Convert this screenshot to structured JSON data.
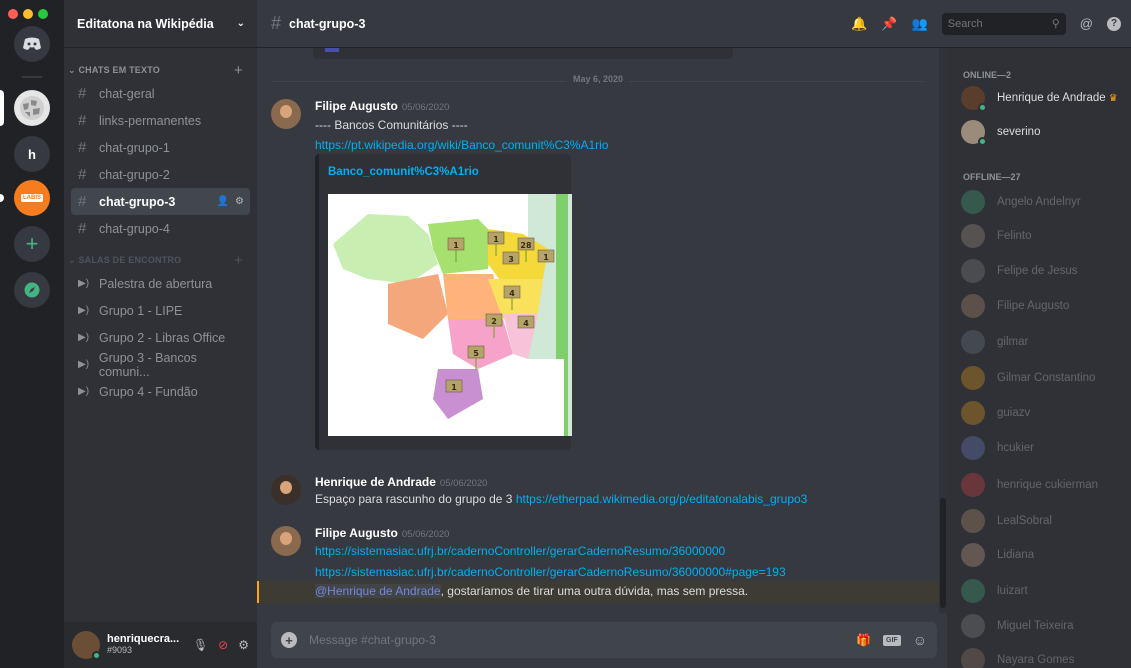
{
  "guild": {
    "name": "Editatona na Wikipédia"
  },
  "rail": {
    "servers": [
      {
        "name": "discord-home",
        "initial": "",
        "color": "#36393f"
      },
      {
        "name": "wikipedia",
        "initial": "",
        "color": "#e6e6e6"
      },
      {
        "name": "h",
        "initial": "h",
        "color": "#36393f"
      },
      {
        "name": "labis",
        "initial": "LABIS",
        "color": "#f57c1f"
      }
    ]
  },
  "categories": {
    "text": "CHATS EM TEXTO",
    "voice": "SALAS DE ENCONTRO"
  },
  "text_channels": [
    "chat-geral",
    "links-permanentes",
    "chat-grupo-1",
    "chat-grupo-2",
    "chat-grupo-3",
    "chat-grupo-4"
  ],
  "voice_channels": [
    "Palestra de abertura",
    "Grupo 1 - LIPE",
    "Grupo 2 - Libras Office",
    "Grupo 3 - Bancos comuni...",
    "Grupo 4 - Fundão"
  ],
  "user": {
    "name": "henriquecra...",
    "tag": "#9093"
  },
  "topbar": {
    "channel": "chat-grupo-3",
    "search_placeholder": "Search"
  },
  "divider": "May 6, 2020",
  "messages": [
    {
      "author": "Filipe Augusto",
      "time": "05/06/2020",
      "lines": [
        "---- Bancos Comunitários ----"
      ],
      "link": "https://pt.wikipedia.org/wiki/Banco_comunit%C3%A1rio",
      "embed_title": "Banco_comunit%C3%A1rio"
    },
    {
      "author": "Henrique de Andrade",
      "time": "05/06/2020",
      "text": "Espaço para rascunho do grupo de 3 ",
      "link": "https://etherpad.wikimedia.org/p/editatonalabis_grupo3"
    },
    {
      "author": "Filipe Augusto",
      "time": "05/06/2020",
      "link1": "https://sistemasiac.ufrj.br/cadernoController/gerarCadernoResumo/36000000",
      "link2": "https://sistemasiac.ufrj.br/cadernoController/gerarCadernoResumo/36000000#page=193",
      "mention": "@Henrique de Andrade",
      "mention_text": ", gostaríamos de tirar uma outra dúvida, mas sem pressa."
    }
  ],
  "map_labels": [
    "1",
    "1",
    "28",
    "3",
    "1",
    "4",
    "2",
    "4",
    "5",
    "1"
  ],
  "composer": {
    "placeholder": "Message #chat-grupo-3"
  },
  "members": {
    "online_header": "ONLINE—2",
    "offline_header": "OFFLINE—27",
    "online": [
      "Henrique de Andrade",
      "severino"
    ],
    "offline": [
      "Angelo Andelnyr",
      "Felinto",
      "Felipe de Jesus",
      "Filipe Augusto",
      "gilmar",
      "Gilmar Constantino",
      "guiazv",
      "hcukier",
      "henrique cukierman",
      "LealSobral",
      "Lidiana",
      "luizart",
      "Miguel Teixeira",
      "Nayara Gomes"
    ]
  },
  "colors": {
    "accent": "#5865f2",
    "link": "#00b0f4",
    "online": "#43b581",
    "mention": "#faa61a"
  }
}
